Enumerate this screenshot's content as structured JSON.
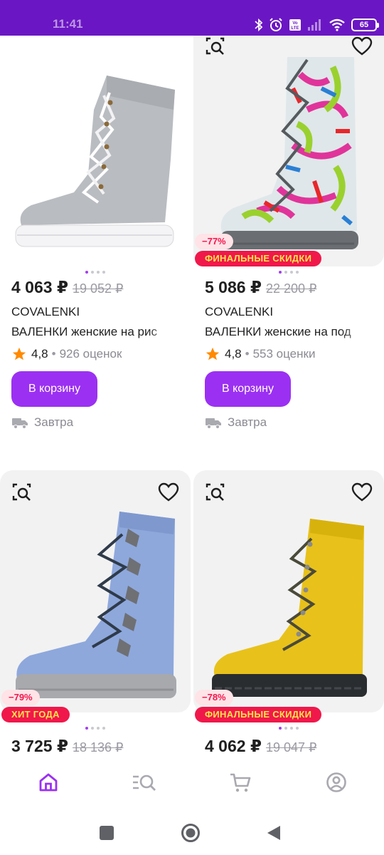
{
  "status_bar": {
    "time": "11:41",
    "battery": "65",
    "icons": [
      "bluetooth-icon",
      "alarm-icon",
      "volte-icon",
      "signal-icon",
      "wifi-icon",
      "battery-icon"
    ]
  },
  "products": [
    {
      "price": "4 063 ₽",
      "old_price": "19 052 ₽",
      "brand": "COVALENKI",
      "title": "ВАЛЕНКИ женские на рис",
      "rating": "4,8",
      "reviews": "926 оценок",
      "cart_label": "В корзину",
      "delivery": "Завтра",
      "discount": "",
      "badge": "",
      "boot_color": "#b9bcc0",
      "sole_color": "#f4f4f6"
    },
    {
      "price": "5 086 ₽",
      "old_price": "22 200 ₽",
      "brand": "COVALENKI",
      "title": "ВАЛЕНКИ женские на под",
      "rating": "4,8",
      "reviews": "553 оценки",
      "cart_label": "В корзину",
      "delivery": "Завтра",
      "discount": "−77%",
      "badge": "ФИНАЛЬНЫЕ СКИДКИ",
      "boot_color": "#dfe7ea",
      "sole_color": "#6a6e72"
    },
    {
      "price": "3 725 ₽",
      "old_price": "18 136 ₽",
      "discount": "−79%",
      "badge": "ХИТ ГОДА",
      "boot_color": "#8ea8dc",
      "sole_color": "#a7a9ad"
    },
    {
      "price": "4 062 ₽",
      "old_price": "19 047 ₽",
      "discount": "−78%",
      "badge": "ФИНАЛЬНЫЕ СКИДКИ",
      "boot_color": "#e8c21a",
      "sole_color": "#2a2d30"
    }
  ],
  "bottom_nav": [
    {
      "icon": "home-icon",
      "active": true
    },
    {
      "icon": "catalog-search-icon",
      "active": false
    },
    {
      "icon": "cart-icon",
      "active": false
    },
    {
      "icon": "profile-icon",
      "active": false
    }
  ],
  "colors": {
    "brand_purple": "#6b16c4",
    "button_purple": "#9b30f2",
    "badge_red": "#f0184a",
    "badge_text": "#ffe64a",
    "star": "#ff8a00"
  }
}
